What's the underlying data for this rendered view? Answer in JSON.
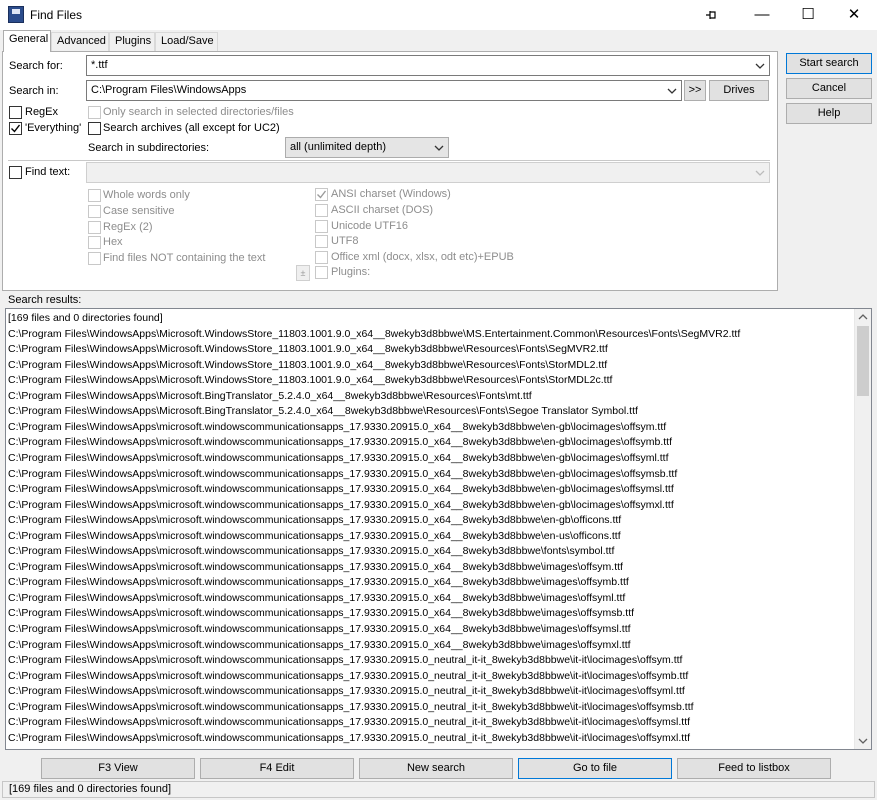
{
  "window": {
    "title": "Find Files",
    "pin_icon": "pin-icon",
    "min_label": "—",
    "max_label": "☐",
    "close_label": "✕"
  },
  "tabs": [
    {
      "label": "General",
      "active": true
    },
    {
      "label": "Advanced",
      "active": false
    },
    {
      "label": "Plugins",
      "active": false
    },
    {
      "label": "Load/Save",
      "active": false
    }
  ],
  "general": {
    "search_for_label": "Search for:",
    "search_for_value": "*.ttf",
    "search_in_label": "Search in:",
    "search_in_value": "C:\\Program Files\\WindowsApps",
    "browse_label": ">>",
    "drives_label": "Drives",
    "regex_label": "RegEx",
    "regex_checked": false,
    "everything_label": "'Everything'",
    "everything_checked": true,
    "only_selected_label": "Only search in selected directories/files",
    "search_archives_label": "Search archives (all except for UC2)",
    "subdir_label": "Search in subdirectories:",
    "subdir_value": "all (unlimited depth)",
    "find_text_label": "Find text:",
    "find_text_value": "",
    "text_options_left": [
      {
        "label": "Whole words only",
        "checked": false
      },
      {
        "label": "Case sensitive",
        "checked": false
      },
      {
        "label": "RegEx (2)",
        "checked": false
      },
      {
        "label": "Hex",
        "checked": false
      },
      {
        "label": "Find files NOT containing the text",
        "checked": false
      }
    ],
    "text_options_right": [
      {
        "label": "ANSI charset (Windows)",
        "checked": true
      },
      {
        "label": "ASCII charset (DOS)",
        "checked": false
      },
      {
        "label": "Unicode UTF16",
        "checked": false
      },
      {
        "label": "UTF8",
        "checked": false
      },
      {
        "label": "Office xml (docx, xlsx, odt etc)+EPUB",
        "checked": false
      },
      {
        "label": "Plugins:",
        "checked": false
      }
    ],
    "plus_label": "±"
  },
  "side_buttons": {
    "start_search": "Start search",
    "cancel": "Cancel",
    "help": "Help"
  },
  "results": {
    "label": "Search results:",
    "lines": [
      "[169 files and 0 directories found]",
      "C:\\Program Files\\WindowsApps\\Microsoft.WindowsStore_11803.1001.9.0_x64__8wekyb3d8bbwe\\MS.Entertainment.Common\\Resources\\Fonts\\SegMVR2.ttf",
      "C:\\Program Files\\WindowsApps\\Microsoft.WindowsStore_11803.1001.9.0_x64__8wekyb3d8bbwe\\Resources\\Fonts\\SegMVR2.ttf",
      "C:\\Program Files\\WindowsApps\\Microsoft.WindowsStore_11803.1001.9.0_x64__8wekyb3d8bbwe\\Resources\\Fonts\\StorMDL2.ttf",
      "C:\\Program Files\\WindowsApps\\Microsoft.WindowsStore_11803.1001.9.0_x64__8wekyb3d8bbwe\\Resources\\Fonts\\StorMDL2c.ttf",
      "C:\\Program Files\\WindowsApps\\Microsoft.BingTranslator_5.2.4.0_x64__8wekyb3d8bbwe\\Resources\\Fonts\\mt.ttf",
      "C:\\Program Files\\WindowsApps\\Microsoft.BingTranslator_5.2.4.0_x64__8wekyb3d8bbwe\\Resources\\Fonts\\Segoe Translator Symbol.ttf",
      "C:\\Program Files\\WindowsApps\\microsoft.windowscommunicationsapps_17.9330.20915.0_x64__8wekyb3d8bbwe\\en-gb\\locimages\\offsym.ttf",
      "C:\\Program Files\\WindowsApps\\microsoft.windowscommunicationsapps_17.9330.20915.0_x64__8wekyb3d8bbwe\\en-gb\\locimages\\offsymb.ttf",
      "C:\\Program Files\\WindowsApps\\microsoft.windowscommunicationsapps_17.9330.20915.0_x64__8wekyb3d8bbwe\\en-gb\\locimages\\offsyml.ttf",
      "C:\\Program Files\\WindowsApps\\microsoft.windowscommunicationsapps_17.9330.20915.0_x64__8wekyb3d8bbwe\\en-gb\\locimages\\offsymsb.ttf",
      "C:\\Program Files\\WindowsApps\\microsoft.windowscommunicationsapps_17.9330.20915.0_x64__8wekyb3d8bbwe\\en-gb\\locimages\\offsymsl.ttf",
      "C:\\Program Files\\WindowsApps\\microsoft.windowscommunicationsapps_17.9330.20915.0_x64__8wekyb3d8bbwe\\en-gb\\locimages\\offsymxl.ttf",
      "C:\\Program Files\\WindowsApps\\microsoft.windowscommunicationsapps_17.9330.20915.0_x64__8wekyb3d8bbwe\\en-gb\\officons.ttf",
      "C:\\Program Files\\WindowsApps\\microsoft.windowscommunicationsapps_17.9330.20915.0_x64__8wekyb3d8bbwe\\en-us\\officons.ttf",
      "C:\\Program Files\\WindowsApps\\microsoft.windowscommunicationsapps_17.9330.20915.0_x64__8wekyb3d8bbwe\\fonts\\symbol.ttf",
      "C:\\Program Files\\WindowsApps\\microsoft.windowscommunicationsapps_17.9330.20915.0_x64__8wekyb3d8bbwe\\images\\offsym.ttf",
      "C:\\Program Files\\WindowsApps\\microsoft.windowscommunicationsapps_17.9330.20915.0_x64__8wekyb3d8bbwe\\images\\offsymb.ttf",
      "C:\\Program Files\\WindowsApps\\microsoft.windowscommunicationsapps_17.9330.20915.0_x64__8wekyb3d8bbwe\\images\\offsyml.ttf",
      "C:\\Program Files\\WindowsApps\\microsoft.windowscommunicationsapps_17.9330.20915.0_x64__8wekyb3d8bbwe\\images\\offsymsb.ttf",
      "C:\\Program Files\\WindowsApps\\microsoft.windowscommunicationsapps_17.9330.20915.0_x64__8wekyb3d8bbwe\\images\\offsymsl.ttf",
      "C:\\Program Files\\WindowsApps\\microsoft.windowscommunicationsapps_17.9330.20915.0_x64__8wekyb3d8bbwe\\images\\offsymxl.ttf",
      "C:\\Program Files\\WindowsApps\\microsoft.windowscommunicationsapps_17.9330.20915.0_neutral_it-it_8wekyb3d8bbwe\\it-it\\locimages\\offsym.ttf",
      "C:\\Program Files\\WindowsApps\\microsoft.windowscommunicationsapps_17.9330.20915.0_neutral_it-it_8wekyb3d8bbwe\\it-it\\locimages\\offsymb.ttf",
      "C:\\Program Files\\WindowsApps\\microsoft.windowscommunicationsapps_17.9330.20915.0_neutral_it-it_8wekyb3d8bbwe\\it-it\\locimages\\offsyml.ttf",
      "C:\\Program Files\\WindowsApps\\microsoft.windowscommunicationsapps_17.9330.20915.0_neutral_it-it_8wekyb3d8bbwe\\it-it\\locimages\\offsymsb.ttf",
      "C:\\Program Files\\WindowsApps\\microsoft.windowscommunicationsapps_17.9330.20915.0_neutral_it-it_8wekyb3d8bbwe\\it-it\\locimages\\offsymsl.ttf",
      "C:\\Program Files\\WindowsApps\\microsoft.windowscommunicationsapps_17.9330.20915.0_neutral_it-it_8wekyb3d8bbwe\\it-it\\locimages\\offsymxl.ttf"
    ]
  },
  "footer_buttons": {
    "f3": "F3 View",
    "f4": "F4 Edit",
    "new_search": "New search",
    "go_to_file": "Go to file",
    "feed": "Feed to listbox"
  },
  "status": "[169 files and 0 directories found]"
}
